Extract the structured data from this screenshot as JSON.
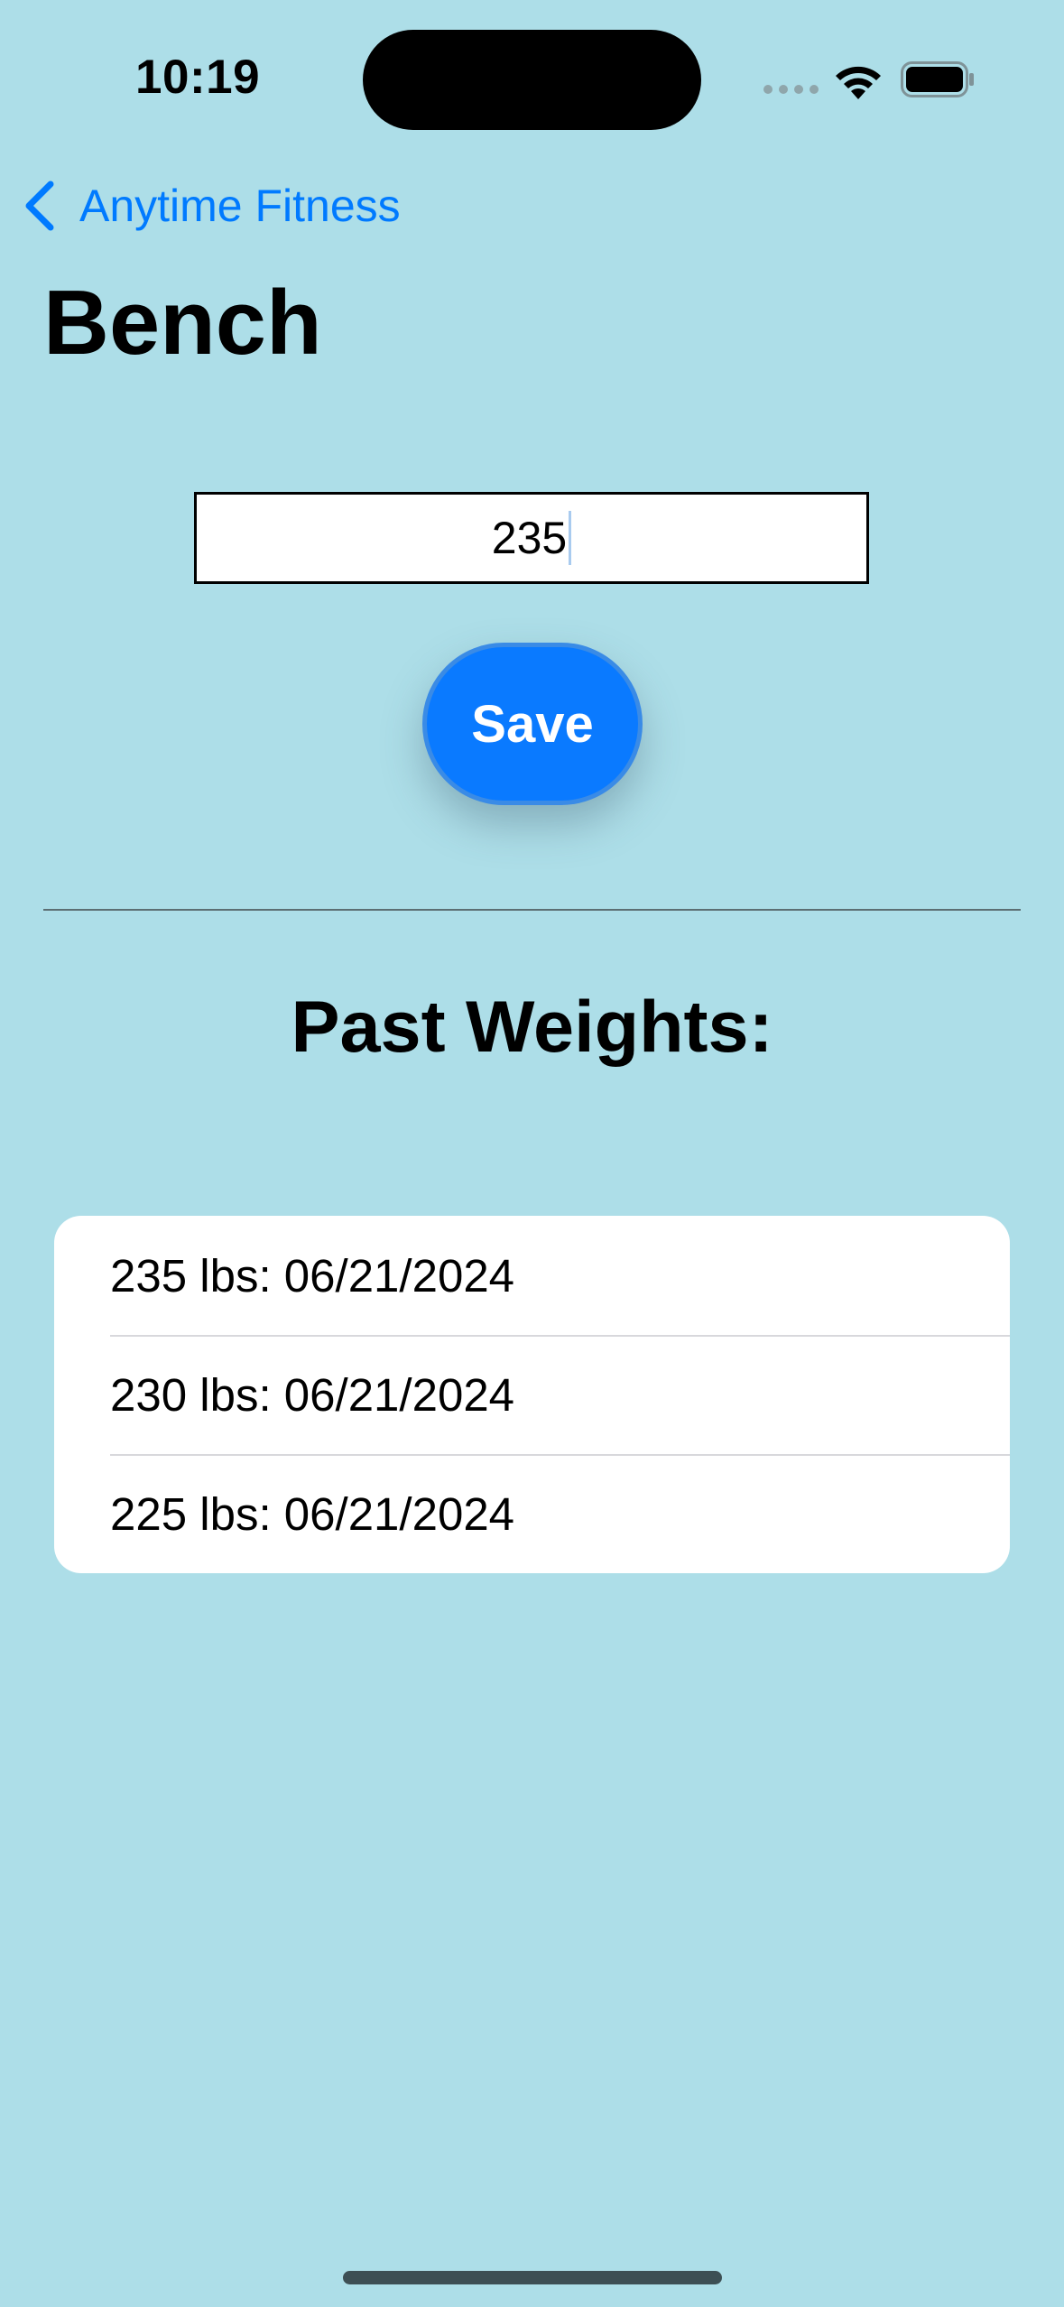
{
  "status_bar": {
    "time": "10:19",
    "icons": [
      "cellular-dots-icon",
      "wifi-icon",
      "battery-icon"
    ]
  },
  "nav": {
    "back_label": "Anytime Fitness",
    "back_icon": "chevron-left-icon"
  },
  "title": "Bench",
  "weight_input": {
    "value": "235"
  },
  "save_button": {
    "label": "Save"
  },
  "past_weights": {
    "heading": "Past Weights:",
    "items": [
      "235 lbs: 06/21/2024",
      "230 lbs: 06/21/2024",
      "225 lbs: 06/21/2024"
    ]
  },
  "colors": {
    "background": "#ADDEE8",
    "accent": "#007AFF",
    "button": "#0A7AFF"
  }
}
